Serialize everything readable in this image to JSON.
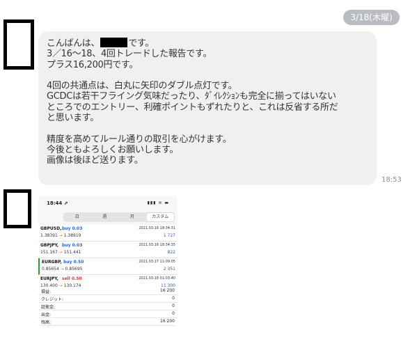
{
  "date_badge": "3/18(木曜)",
  "message": {
    "greeting_before": "こんばんは、",
    "greeting_after": "です。",
    "lines_a": [
      "3／16〜18、4回トレードした報告です。",
      "プラス16,200円です。"
    ],
    "lines_b": [
      "4回の共通点は、白丸に矢印のダブル点灯です。",
      "GCDCは若干フライング気味だったり、ﾀﾞｲﾚｸｼｮﾝも完全に揃ってはいない",
      "ところでのエントリー、利確ポイントもずれたりと、これは反省する所だ",
      "と思います。"
    ],
    "lines_c": [
      "精度を高めてルール通りの取引を心がけます。",
      "今後ともよろしくお願いします。",
      "画像は後ほど送ります。"
    ],
    "time": "18:53"
  },
  "screenshot": {
    "status_time": "18:44 ⇗",
    "status_icons": "▮▮▮ ≋ ▬",
    "tabs": [
      "日",
      "週",
      "月",
      "カスタム"
    ],
    "trades": [
      {
        "symbol": "GBPUSD,",
        "side": "buy 0.03",
        "date": "2021.03.16 18:34:31",
        "open": "1.38391",
        "close": "1.38919",
        "profit": "1 727"
      },
      {
        "symbol": "GBPJPY,",
        "side": "buy 0.03",
        "date": "2021.03.16 18:34:35",
        "open": "151.167",
        "close": "151.441",
        "profit": "822"
      },
      {
        "symbol": "EURGBP,",
        "side": "buy 0.50",
        "date": "2021.03.17 11:09:05",
        "open": "0.85654",
        "close": "0.85695",
        "profit": "2 351"
      },
      {
        "symbol": "EURJPY,",
        "side": "sell 0.50",
        "date": "2021.03.18 01:03:40",
        "open": "130.400",
        "close": "130.174",
        "profit": "11 300"
      }
    ],
    "summary": [
      {
        "label": "損益:",
        "value": "16 200"
      },
      {
        "label": "クレジット:",
        "value": "0"
      },
      {
        "label": "証拠金:",
        "value": "0"
      },
      {
        "label": "出金:",
        "value": "0"
      },
      {
        "label": "残高:",
        "value": "16 200"
      }
    ]
  }
}
